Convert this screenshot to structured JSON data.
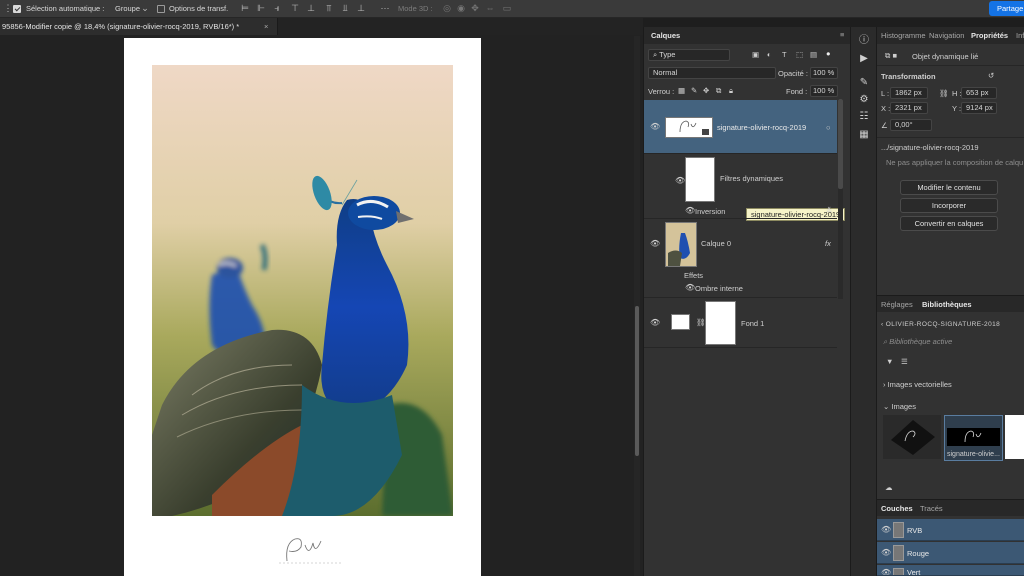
{
  "options_bar": {
    "auto_select_label": "Sélection automatique :",
    "auto_select_value": "Groupe",
    "transform_label": "Options de transf.",
    "mode3d_label": "Mode 3D :",
    "share_label": "Partage"
  },
  "document": {
    "tab_title": "95856-Modifier copie @ 18,4% (signature-olivier-rocq-2019, RVB/16*) *",
    "close_glyph": "×"
  },
  "layers_panel": {
    "tab_label": "Calques",
    "filter_value": "Type",
    "blend_mode": "Normal",
    "opacity_label": "Opacité :",
    "opacity_value": "100 %",
    "lock_label": "Verrou :",
    "fill_label": "Fond :",
    "fill_value": "100 %",
    "layers": [
      {
        "name": "signature-olivier-rocq-2019",
        "tooltip": "signature-olivier-rocq-2019"
      },
      {
        "name": "Filtres dynamiques",
        "sub": "Inversion"
      },
      {
        "name": "Calque 0",
        "effects_label": "Effets",
        "effect": "Ombre interne",
        "fx": "fx"
      },
      {
        "name": "Fond 1"
      }
    ]
  },
  "properties_panel": {
    "tabs": [
      "Histogramme",
      "Navigation",
      "Propriétés",
      "Infe"
    ],
    "object_type": "Objet dynamique lié",
    "transformation_label": "Transformation",
    "w_label": "L :",
    "w_value": "1862 px",
    "h_label": "H :",
    "h_value": "653 px",
    "x_label": "X :",
    "x_value": "2321 px",
    "y_label": "Y :",
    "y_value": "9124 px",
    "angle_value": "0,00°",
    "file_path": ".../signature-olivier-rocq-2019",
    "comp_note": "Ne pas appliquer la composition de calqu",
    "buttons": [
      "Modifier le contenu",
      "Incorporer",
      "Convertir en calques"
    ]
  },
  "libraries_panel": {
    "tabs": [
      "Réglages",
      "Bibliothèques"
    ],
    "library_name": "OLIVIER-ROCQ-SIGNATURE-2018",
    "search_placeholder": "Bibliothèque active",
    "section_vector": "Images vectorielles",
    "section_images": "Images",
    "selected_item": "signature-olivie..."
  },
  "channels_panel": {
    "tabs": [
      "Couches",
      "Tracés"
    ],
    "channels": [
      "RVB",
      "Rouge",
      "Vert"
    ]
  }
}
